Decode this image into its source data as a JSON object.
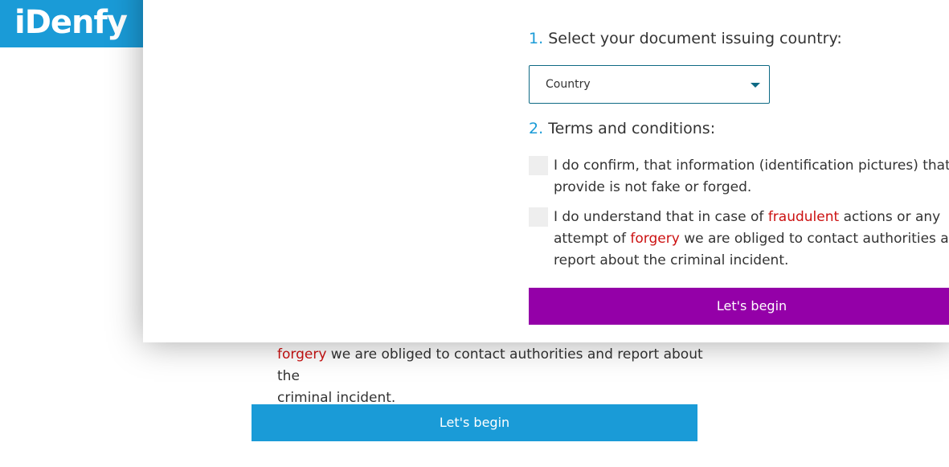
{
  "brand": {
    "logo_text": "iDenfy",
    "accent_color": "#1a9bd7",
    "primary_button_color": "#9400a8",
    "warning_color": "#cc1111"
  },
  "background": {
    "terms_line1_red": "forgery",
    "terms_line1_rest": " we are obliged to contact authorities and report about the",
    "terms_line2": "criminal incident.",
    "button_label": "Let's begin"
  },
  "modal": {
    "step1": {
      "number": "1.",
      "label": "Select your document issuing country:"
    },
    "country_select": {
      "value": "Country",
      "icon": "chevron-down-icon"
    },
    "step2": {
      "number": "2.",
      "label": "Terms and conditions:"
    },
    "terms": [
      {
        "text": "I do confirm, that information (identification pictures) that I provide is not fake or forged.",
        "checked": false
      },
      {
        "part1": "I do understand that in case of ",
        "red1": "fraudulent",
        "part2": " actions or any attempt of ",
        "red2": "forgery",
        "part3": " we are obliged to contact authorities and report about the criminal incident.",
        "checked": false
      }
    ],
    "begin_button_label": "Let's begin"
  }
}
